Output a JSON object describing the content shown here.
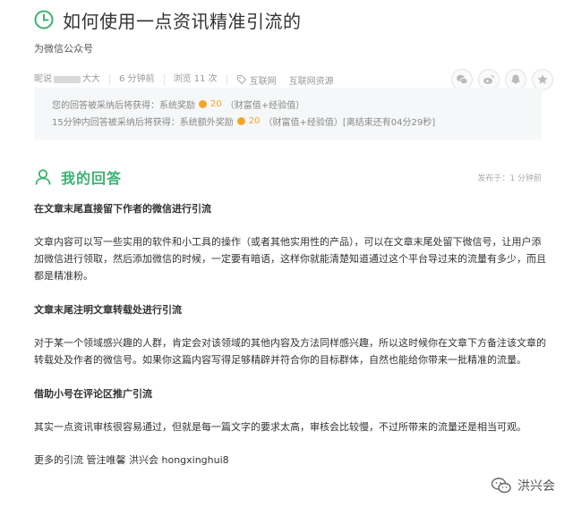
{
  "question": {
    "title": "如何使用一点资讯精准引流的",
    "subtitle": "为微信公众号"
  },
  "meta": {
    "author_prefix": "昵说",
    "author_suffix": "大大",
    "time": "6 分钟前",
    "views": "浏览 11 次",
    "tags": [
      "互联网",
      "互联网资源"
    ]
  },
  "share_icons": [
    "wechat-icon",
    "weibo-icon",
    "qq-icon",
    "star-icon"
  ],
  "reward": {
    "line1_prefix": "您的回答被采纳后将获得：系统奖励",
    "line1_value": "20",
    "line1_suffix": "（财富值+经验值）",
    "line2_prefix": "15分钟内回答被采纳后将获得：系统额外奖励",
    "line2_value": "20",
    "line2_suffix": "（财富值+经验值）[离结束还有04分29秒]"
  },
  "answer": {
    "header": "我的回答",
    "posted": "发布于：1 分钟前",
    "paragraphs": [
      {
        "heading": true,
        "text": "在文章末尾直接留下作者的微信进行引流"
      },
      {
        "heading": false,
        "text": "文章内容可以写一些实用的软件和小工具的操作（或者其他实用性的产品），可以在文章末尾处留下微信号，让用户添加微信进行领取，然后添加微信的时候，一定要有暗语，这样你就能清楚知道通过这个平台导过来的流量有多少，而且都是精准粉。"
      },
      {
        "heading": true,
        "text": "文章末尾注明文章转载处进行引流"
      },
      {
        "heading": false,
        "text": "对于某一个领域感兴趣的人群，肯定会对该领域的其他内容及方法同样感兴趣，所以这时候你在文章下方备注该文章的转载处及作者的微信号。如果你这篇内容写得足够精辟并符合你的目标群体，自然也能给你带来一批精准的流量。"
      },
      {
        "heading": true,
        "text": "借助小号在评论区推广引流"
      },
      {
        "heading": false,
        "text": "其实一点资讯审核很容易通过，但就是每一篇文字的要求太高，审核会比较慢，不过所带来的流量还是相当可观。"
      },
      {
        "heading": false,
        "text": "更多的引流 管注唯馨 洪兴会 hongxinghui8"
      }
    ]
  },
  "watermark": {
    "text": "洪兴会"
  },
  "colors": {
    "accent_green": "#3cb371",
    "coin_orange": "#f5a623"
  }
}
